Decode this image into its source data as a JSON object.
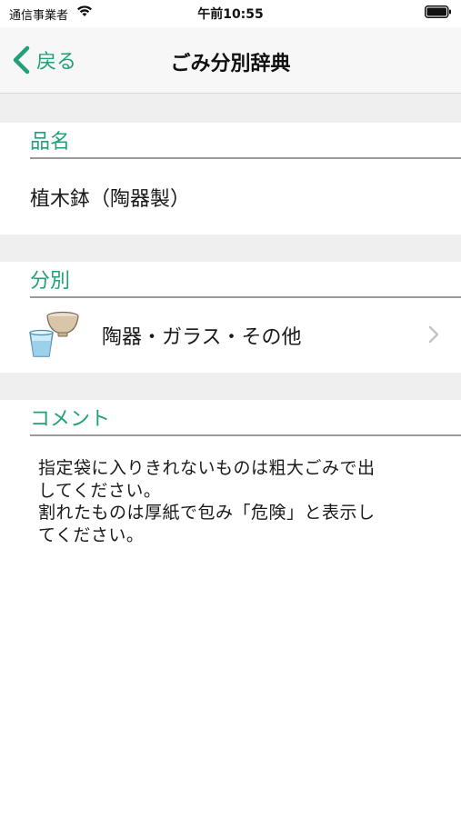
{
  "status_bar": {
    "carrier": "通信事業者",
    "time": "午前10:55"
  },
  "nav": {
    "back_label": "戻る",
    "title": "ごみ分別辞典"
  },
  "sections": {
    "item_name_header": "品名",
    "category_header": "分別",
    "comment_header": "コメント"
  },
  "item": {
    "name": "植木鉢（陶器製）",
    "category": "陶器・ガラス・その他",
    "category_icon": "bowl-and-glass-icon",
    "comment_lines": [
      "指定袋に入りきれないものは粗大ごみで出",
      "してください。",
      "割れたものは厚紙で包み「危険」と表示し",
      "てください。"
    ]
  },
  "colors": {
    "accent": "#21a07a",
    "separator_band": "#efefef",
    "nav_background": "#f7f7f7"
  }
}
